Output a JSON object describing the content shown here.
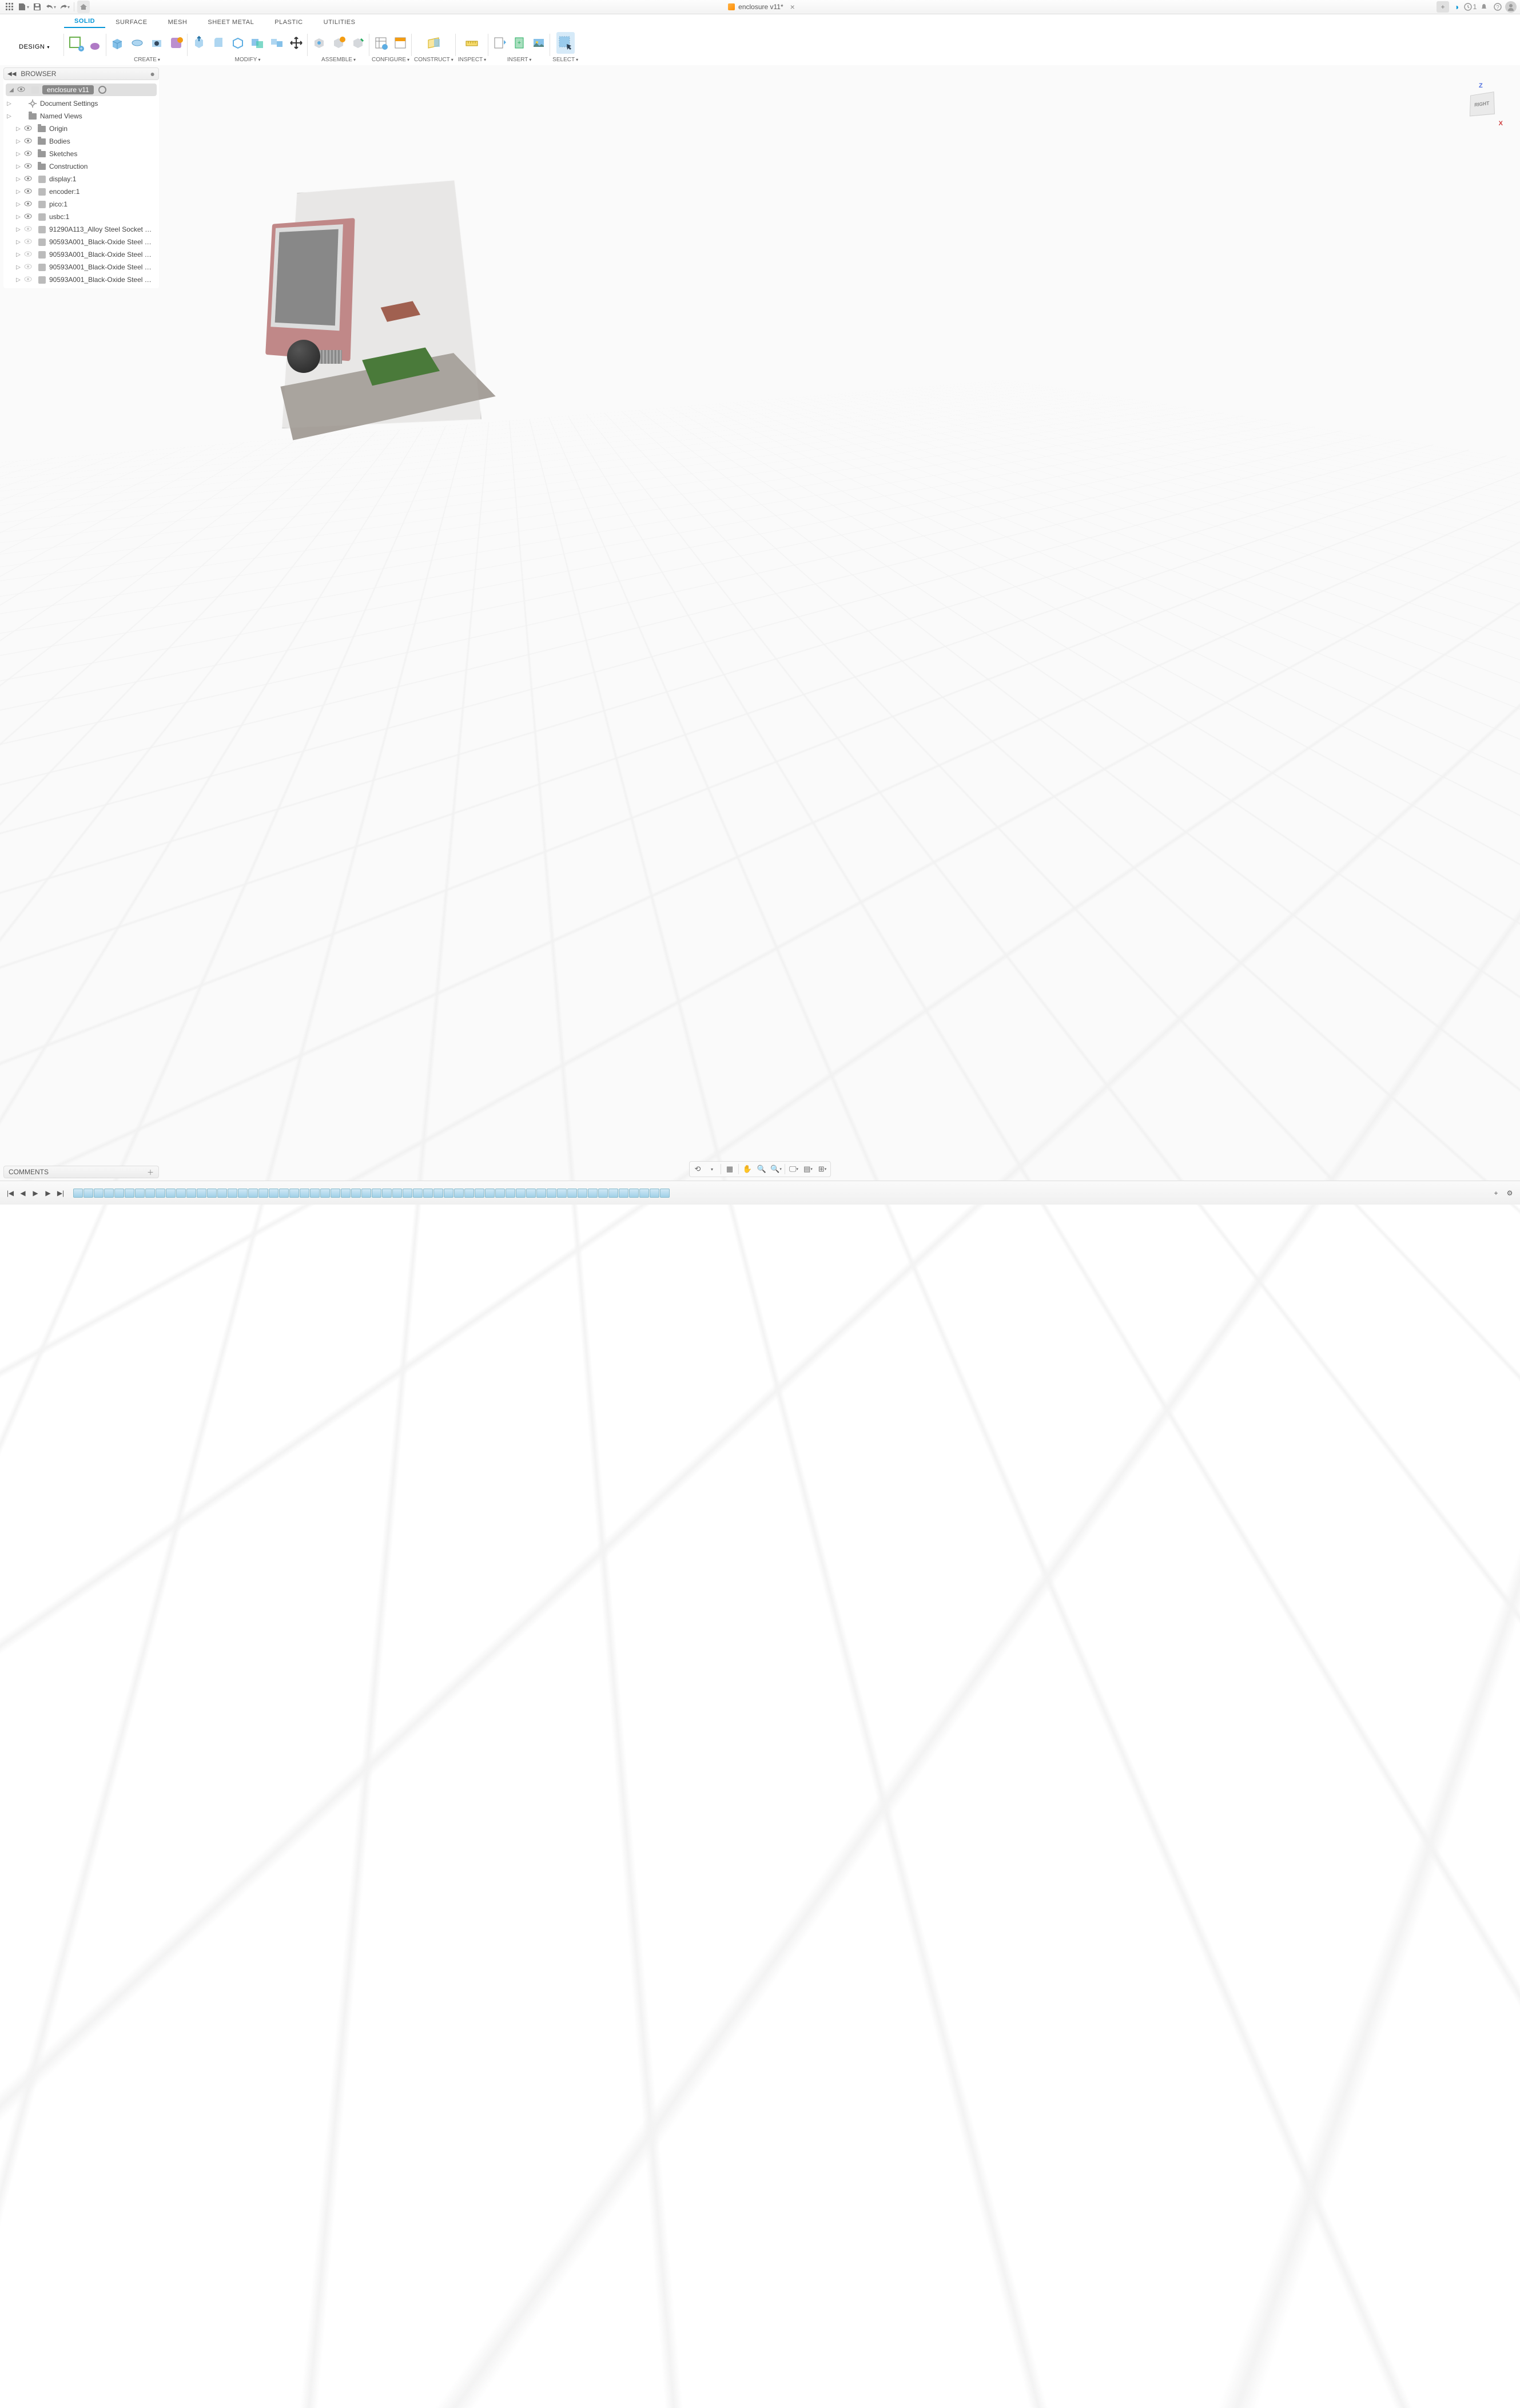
{
  "title": "enclosure v11*",
  "job_count": "1",
  "workspace_name": "DESIGN",
  "ribbon_tabs": [
    "SOLID",
    "SURFACE",
    "MESH",
    "SHEET METAL",
    "PLASTIC",
    "UTILITIES"
  ],
  "active_tab": "SOLID",
  "groups": {
    "create": "CREATE",
    "modify": "MODIFY",
    "assemble": "ASSEMBLE",
    "configure": "CONFIGURE",
    "construct": "CONSTRUCT",
    "inspect": "INSPECT",
    "insert": "INSERT",
    "select": "SELECT"
  },
  "browser": {
    "title": "BROWSER",
    "root": "enclosure v11",
    "items": [
      {
        "name": "Document Settings",
        "icon": "gear",
        "vis": ""
      },
      {
        "name": "Named Views",
        "icon": "folder",
        "vis": ""
      },
      {
        "name": "Origin",
        "icon": "folder",
        "vis": "on",
        "indent": 1
      },
      {
        "name": "Bodies",
        "icon": "folder",
        "vis": "on",
        "indent": 1
      },
      {
        "name": "Sketches",
        "icon": "folder",
        "vis": "on",
        "indent": 1
      },
      {
        "name": "Construction",
        "icon": "folder",
        "vis": "on",
        "indent": 1
      },
      {
        "name": "display:1",
        "icon": "comp",
        "vis": "on",
        "indent": 1
      },
      {
        "name": "encoder:1",
        "icon": "comp",
        "vis": "on",
        "indent": 1
      },
      {
        "name": "pico:1",
        "icon": "comp",
        "vis": "on",
        "indent": 1
      },
      {
        "name": "usbc:1",
        "icon": "comp",
        "vis": "on",
        "indent": 1
      },
      {
        "name": "91290A113_Alloy Steel Socket …",
        "icon": "comp",
        "vis": "off",
        "indent": 1
      },
      {
        "name": "90593A001_Black-Oxide Steel …",
        "icon": "comp",
        "vis": "off",
        "indent": 1
      },
      {
        "name": "90593A001_Black-Oxide Steel …",
        "icon": "comp",
        "vis": "off",
        "indent": 1
      },
      {
        "name": "90593A001_Black-Oxide Steel …",
        "icon": "comp",
        "vis": "off",
        "indent": 1
      },
      {
        "name": "90593A001_Black-Oxide Steel …",
        "icon": "comp",
        "vis": "off",
        "indent": 1
      }
    ]
  },
  "comments": "COMMENTS",
  "viewcube": {
    "face": "RIGHT",
    "z": "Z",
    "x": "X"
  },
  "timeline_count": 58
}
